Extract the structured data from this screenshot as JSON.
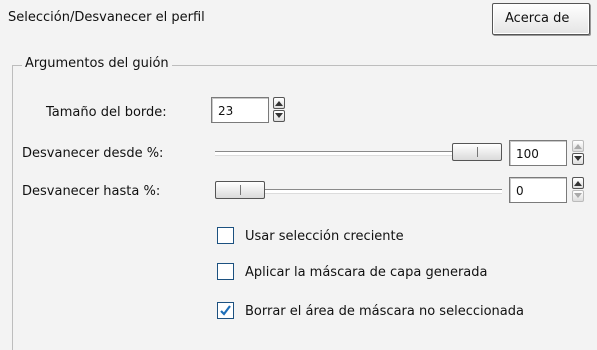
{
  "header": {
    "title": "Selección/Desvanecer el perfil",
    "about_button": "Acerca de"
  },
  "group": {
    "title": "Argumentos del guión"
  },
  "fields": {
    "border_size": {
      "label": "Tamaño del borde:",
      "value": "23"
    },
    "fade_from": {
      "label": "Desvanecer desde %:",
      "value": "100",
      "slider_percent": 100
    },
    "fade_to": {
      "label": "Desvanecer hasta %:",
      "value": "0",
      "slider_percent": 0
    }
  },
  "options": [
    {
      "label": "Usar selección creciente",
      "checked": false
    },
    {
      "label": "Aplicar la máscara de capa generada",
      "checked": false
    },
    {
      "label": "Borrar el área de máscara no seleccionada",
      "checked": true
    }
  ],
  "colors": {
    "check_accent": "#1f6fb8",
    "checkbox_border": "#1c5180"
  }
}
